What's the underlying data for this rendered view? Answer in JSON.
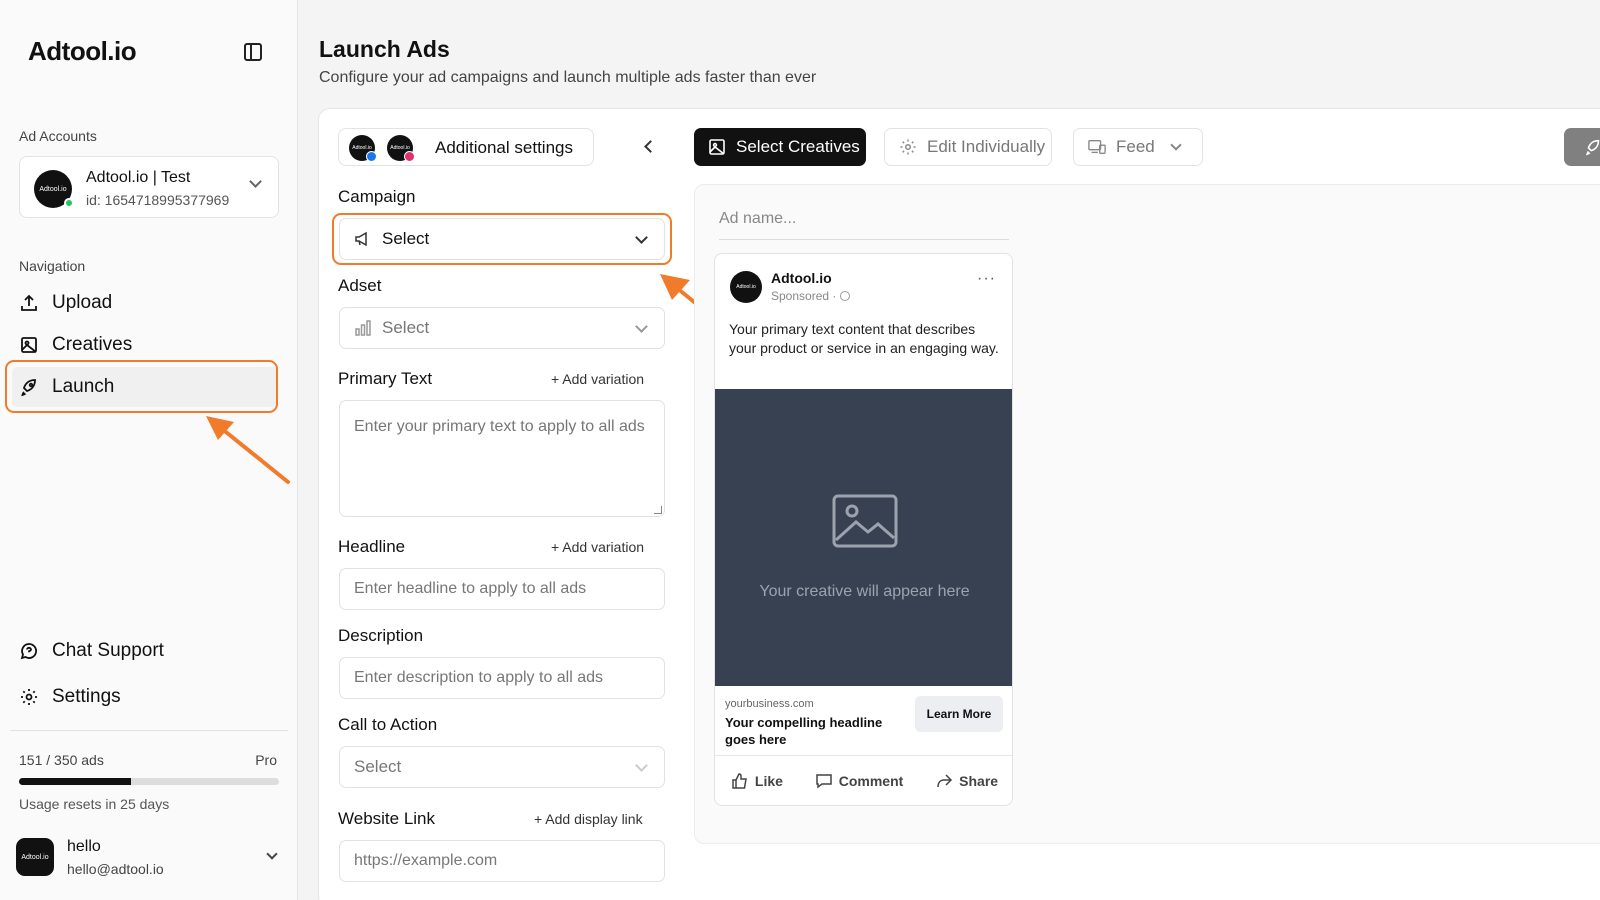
{
  "app": {
    "logo": "Adtool.io"
  },
  "sidebar": {
    "ad_accounts_label": "Ad Accounts",
    "account": {
      "name": "Adtool.io | Test",
      "id": "id: 1654718995377969",
      "avatar_text": "Adtool.io"
    },
    "navigation_label": "Navigation",
    "nav": [
      {
        "label": "Upload",
        "icon": "upload-icon"
      },
      {
        "label": "Creatives",
        "icon": "image-icon"
      },
      {
        "label": "Launch",
        "icon": "rocket-icon",
        "active": true
      }
    ],
    "bottom_nav": [
      {
        "label": "Chat Support",
        "icon": "chat-icon"
      },
      {
        "label": "Settings",
        "icon": "gear-icon"
      }
    ],
    "usage": {
      "count": "151 / 350 ads",
      "plan": "Pro",
      "used": 151,
      "limit": 350,
      "reset": "Usage resets in 25 days"
    },
    "user": {
      "name": "hello",
      "email": "hello@adtool.io",
      "avatar_text": "Adtool.io"
    }
  },
  "main": {
    "title": "Launch Ads",
    "subtitle": "Configure your ad campaigns and launch multiple ads faster than ever",
    "settings_button": "Additional settings",
    "mini_logo_text": "Adtool.io",
    "form": {
      "campaign": {
        "label": "Campaign",
        "value": "Select"
      },
      "adset": {
        "label": "Adset",
        "value": "Select"
      },
      "primary_text": {
        "label": "Primary Text",
        "add": "Add variation",
        "placeholder": "Enter your primary text to apply to all ads"
      },
      "headline": {
        "label": "Headline",
        "add": "Add variation",
        "placeholder": "Enter headline to apply to all ads"
      },
      "description": {
        "label": "Description",
        "placeholder": "Enter description to apply to all ads"
      },
      "cta": {
        "label": "Call to Action",
        "value": "Select"
      },
      "website": {
        "label": "Website Link",
        "add": "Add display link",
        "placeholder": "https://example.com"
      }
    },
    "toolbar": {
      "select_creatives": "Select Creatives",
      "edit_individually": "Edit Individually",
      "feed": "Feed"
    },
    "preview": {
      "ad_name_placeholder": "Ad name...",
      "brand": "Adtool.io",
      "avatar_text": "Adtool.io",
      "sponsored": "Sponsored ·",
      "more": "···",
      "primary_text": "Your primary text content that describes your product or service in an engaging way.",
      "media_placeholder": "Your creative will appear here",
      "domain": "yourbusiness.com",
      "headline": "Your compelling headline goes here",
      "cta": "Learn More",
      "actions": {
        "like": "Like",
        "comment": "Comment",
        "share": "Share"
      }
    }
  },
  "colors": {
    "highlight": "#f07b2a",
    "media_bg": "#374151",
    "accent": "#111111",
    "online": "#22c55e"
  }
}
